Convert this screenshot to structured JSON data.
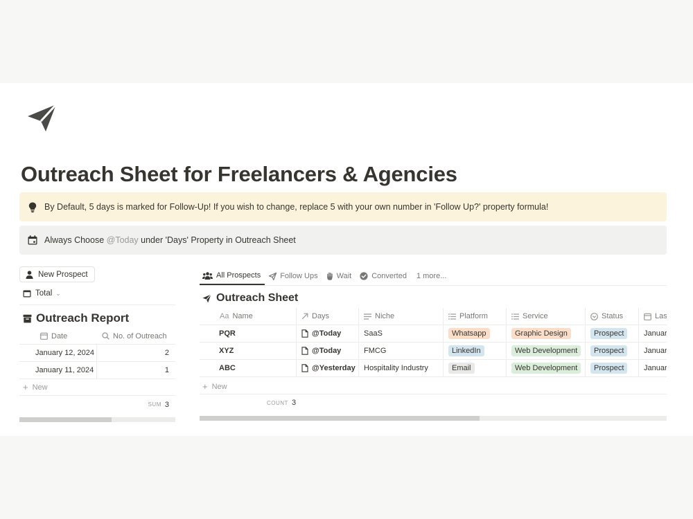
{
  "page": {
    "title": "Outreach Sheet for Freelancers & Agencies",
    "icon": "paper-plane-icon"
  },
  "callouts": {
    "followup": {
      "icon": "lightbulb-icon",
      "text": "By Default, 5 days is marked for Follow-Up! If you wish to change, replace 5 with your own number in 'Follow Up?' property formula!"
    },
    "days": {
      "icon": "calendar-icon",
      "text_before": "Always Choose ",
      "mention": "@Today",
      "text_after": " under 'Days' Property in Outreach Sheet"
    }
  },
  "left": {
    "new_button": "New Prospect",
    "total_label": "Total",
    "report": {
      "title": "Outreach Report",
      "columns": {
        "date": "Date",
        "count": "No. of Outreach"
      },
      "rows": [
        {
          "date": "January 12, 2024",
          "count": "2"
        },
        {
          "date": "January 11, 2024",
          "count": "1"
        }
      ],
      "new_label": "New",
      "sum_label": "SUM",
      "sum_value": "3"
    },
    "scroll_fraction": 0.59
  },
  "right": {
    "tabs": [
      {
        "label": "All Prospects",
        "icon": "people-icon",
        "active": true
      },
      {
        "label": "Follow Ups",
        "icon": "paper-plane-icon",
        "active": false
      },
      {
        "label": "Wait",
        "icon": "hand-icon",
        "active": false
      },
      {
        "label": "Converted",
        "icon": "check-badge-icon",
        "active": false
      },
      {
        "label": "1 more...",
        "icon": "",
        "active": false
      }
    ],
    "sheet": {
      "title": "Outreach Sheet",
      "columns": {
        "name": "Name",
        "name_prefix": "Aa",
        "days": "Days",
        "niche": "Niche",
        "platform": "Platform",
        "service": "Service",
        "status": "Status",
        "last": "Las"
      },
      "rows": [
        {
          "name": "PQR",
          "days": "@Today",
          "niche": "SaaS",
          "platform": "Whatsapp",
          "service": "Graphic Design",
          "status": "Prospect",
          "last": "January"
        },
        {
          "name": "XYZ",
          "days": "@Today",
          "niche": "FMCG",
          "platform": "LinkedIn",
          "service": "Web Development",
          "status": "Prospect",
          "last": "January"
        },
        {
          "name": "ABC",
          "days": "@Yesterday",
          "niche": "Hospitality Industry",
          "platform": "Email",
          "service": "Web Development",
          "status": "Prospect",
          "last": "January"
        }
      ],
      "new_label": "New",
      "count_label": "COUNT",
      "count_value": "3"
    },
    "scroll_fraction": 0.6
  },
  "colors": {
    "whatsapp_pill": "#fadec9",
    "linkedin_pill": "#d3e5ef",
    "email_pill": "#e9e9e7",
    "graphic_design_pill": "#fadec9",
    "web_development_pill": "#dbeddb",
    "prospect_pill": "#d3e5ef",
    "callout_yellow": "#fbf3db",
    "callout_gray": "#f1f1ef"
  }
}
